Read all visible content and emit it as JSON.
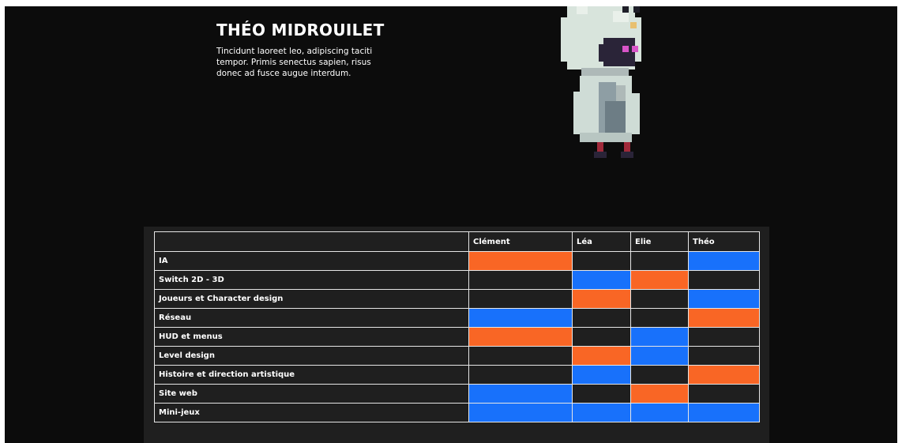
{
  "profile": {
    "name": "THÉO MIDROUILET",
    "description": "Tincidunt laoreet leo, adipiscing taciti tempor. Primis senectus sapien, risus donec ad fusce augue interdum."
  },
  "colors": {
    "page_bg": "#0c0c0c",
    "panel_bg": "#1f1f1f",
    "orange": "#f96625",
    "blue": "#1871fb",
    "border": "#e6e6e6"
  },
  "table": {
    "columns": [
      "",
      "Clément",
      "Léa",
      "Elie",
      "Théo"
    ],
    "rows": [
      {
        "label": "IA",
        "cells": [
          "orange",
          "empty",
          "empty",
          "blue"
        ]
      },
      {
        "label": "Switch 2D - 3D",
        "cells": [
          "empty",
          "blue",
          "orange",
          "empty"
        ]
      },
      {
        "label": "Joueurs et Character design",
        "cells": [
          "empty",
          "orange",
          "empty",
          "blue"
        ]
      },
      {
        "label": "Réseau",
        "cells": [
          "blue",
          "empty",
          "empty",
          "orange"
        ]
      },
      {
        "label": "HUD et menus",
        "cells": [
          "orange",
          "empty",
          "blue",
          "empty"
        ]
      },
      {
        "label": "Level design",
        "cells": [
          "empty",
          "orange",
          "blue",
          "empty"
        ]
      },
      {
        "label": "Histoire et direction artistique",
        "cells": [
          "empty",
          "blue",
          "empty",
          "orange"
        ]
      },
      {
        "label": "Site web",
        "cells": [
          "blue",
          "empty",
          "orange",
          "empty"
        ]
      },
      {
        "label": "Mini-jeux",
        "cells": [
          "blue",
          "blue",
          "blue",
          "blue"
        ]
      }
    ]
  }
}
